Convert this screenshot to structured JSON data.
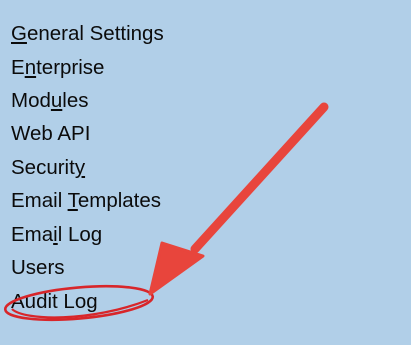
{
  "menu": {
    "items": [
      {
        "pre": "",
        "key": "G",
        "post": "eneral Settings"
      },
      {
        "pre": "E",
        "key": "n",
        "post": "terprise"
      },
      {
        "pre": "Mod",
        "key": "u",
        "post": "les"
      },
      {
        "pre": "Web API",
        "key": "",
        "post": ""
      },
      {
        "pre": "Securit",
        "key": "y",
        "post": ""
      },
      {
        "pre": "Email ",
        "key": "T",
        "post": "emplates"
      },
      {
        "pre": "Ema",
        "key": "i",
        "post": "l Log"
      },
      {
        "pre": "Users",
        "key": "",
        "post": ""
      },
      {
        "pre": "Audit Log",
        "key": "",
        "post": ""
      }
    ]
  },
  "annotation": {
    "highlighted_item": "Audit Log",
    "arrow_color": "#e8453c",
    "ellipse_color": "#d8262a",
    "arrow_icon": "arrow-pointer-icon",
    "ellipse_icon": "highlight-ellipse-icon"
  },
  "colors": {
    "background": "#b1cfe8",
    "text": "#0b0b0b"
  }
}
